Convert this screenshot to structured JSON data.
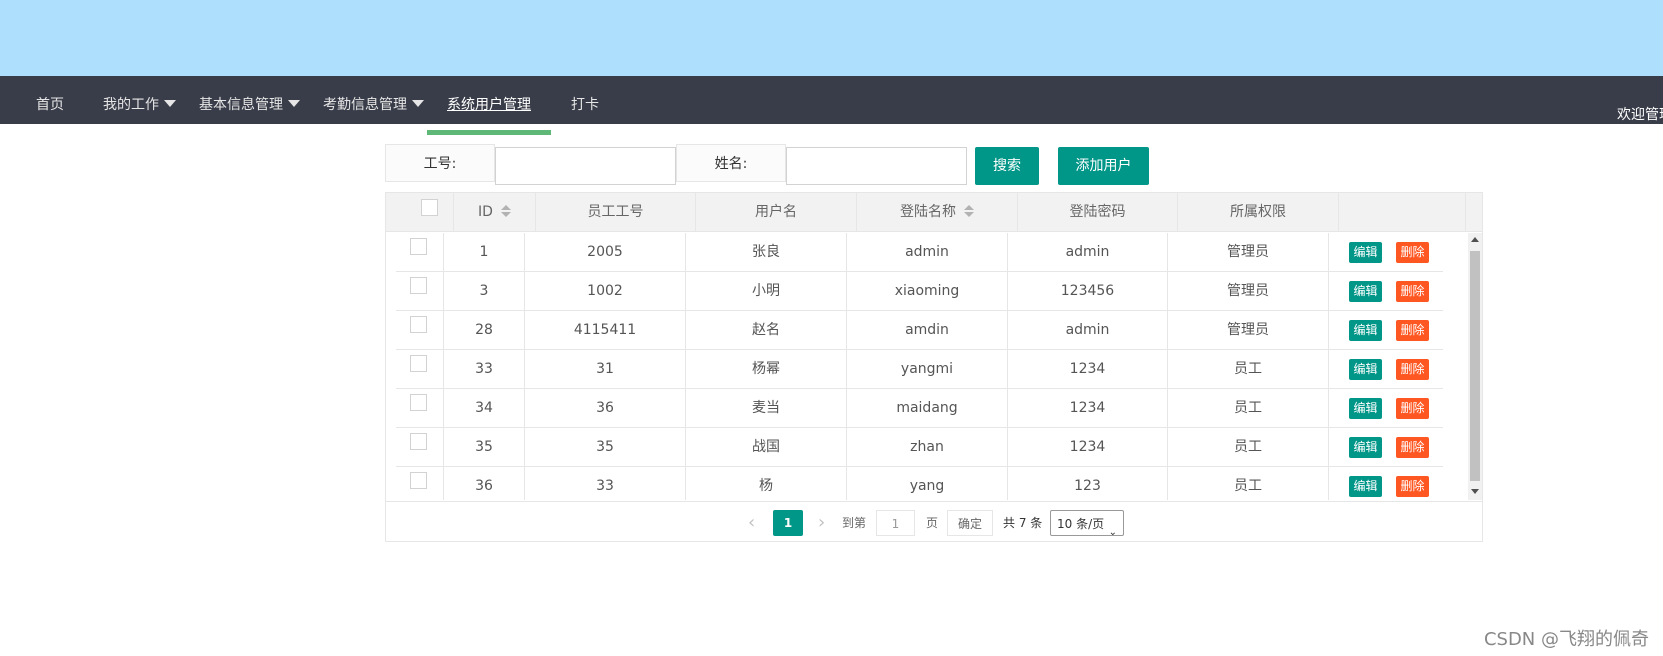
{
  "nav": {
    "items": [
      {
        "label": "首页",
        "dropdown": false
      },
      {
        "label": "我的工作",
        "dropdown": true
      },
      {
        "label": "基本信息管理",
        "dropdown": true
      },
      {
        "label": "考勤信息管理",
        "dropdown": true
      },
      {
        "label": "系统用户管理",
        "dropdown": false,
        "active": true
      },
      {
        "label": "打卡",
        "dropdown": false
      }
    ],
    "welcome": "欢迎管理员"
  },
  "search": {
    "job_no_label": "工号:",
    "job_no_value": "",
    "name_label": "姓名:",
    "name_value": "",
    "search_button": "搜索",
    "add_button": "添加用户"
  },
  "table": {
    "headers": {
      "id": "ID",
      "emp_no": "员工工号",
      "username": "用户名",
      "login_name": "登陆名称",
      "password": "登陆密码",
      "role": "所属权限"
    },
    "edit_label": "编辑",
    "delete_label": "删除",
    "rows": [
      {
        "id": "1",
        "emp_no": "2005",
        "username": "张良",
        "login_name": "admin",
        "password": "admin",
        "role": "管理员"
      },
      {
        "id": "3",
        "emp_no": "1002",
        "username": "小明",
        "login_name": "xiaoming",
        "password": "123456",
        "role": "管理员"
      },
      {
        "id": "28",
        "emp_no": "4115411",
        "username": "赵名",
        "login_name": "amdin",
        "password": "admin",
        "role": "管理员"
      },
      {
        "id": "33",
        "emp_no": "31",
        "username": "杨幂",
        "login_name": "yangmi",
        "password": "1234",
        "role": "员工"
      },
      {
        "id": "34",
        "emp_no": "36",
        "username": "麦当",
        "login_name": "maidang",
        "password": "1234",
        "role": "员工"
      },
      {
        "id": "35",
        "emp_no": "35",
        "username": "战国",
        "login_name": "zhan",
        "password": "1234",
        "role": "员工"
      },
      {
        "id": "36",
        "emp_no": "33",
        "username": "杨",
        "login_name": "yang",
        "password": "123",
        "role": "员工"
      }
    ]
  },
  "pager": {
    "prev": "‹",
    "current": "1",
    "next": "›",
    "goto_label": "到第",
    "goto_value": "1",
    "page_label": "页",
    "confirm": "确定",
    "total": "共 7 条",
    "per_page": "10 条/页"
  },
  "watermark": "CSDN @飞翔的佩奇"
}
